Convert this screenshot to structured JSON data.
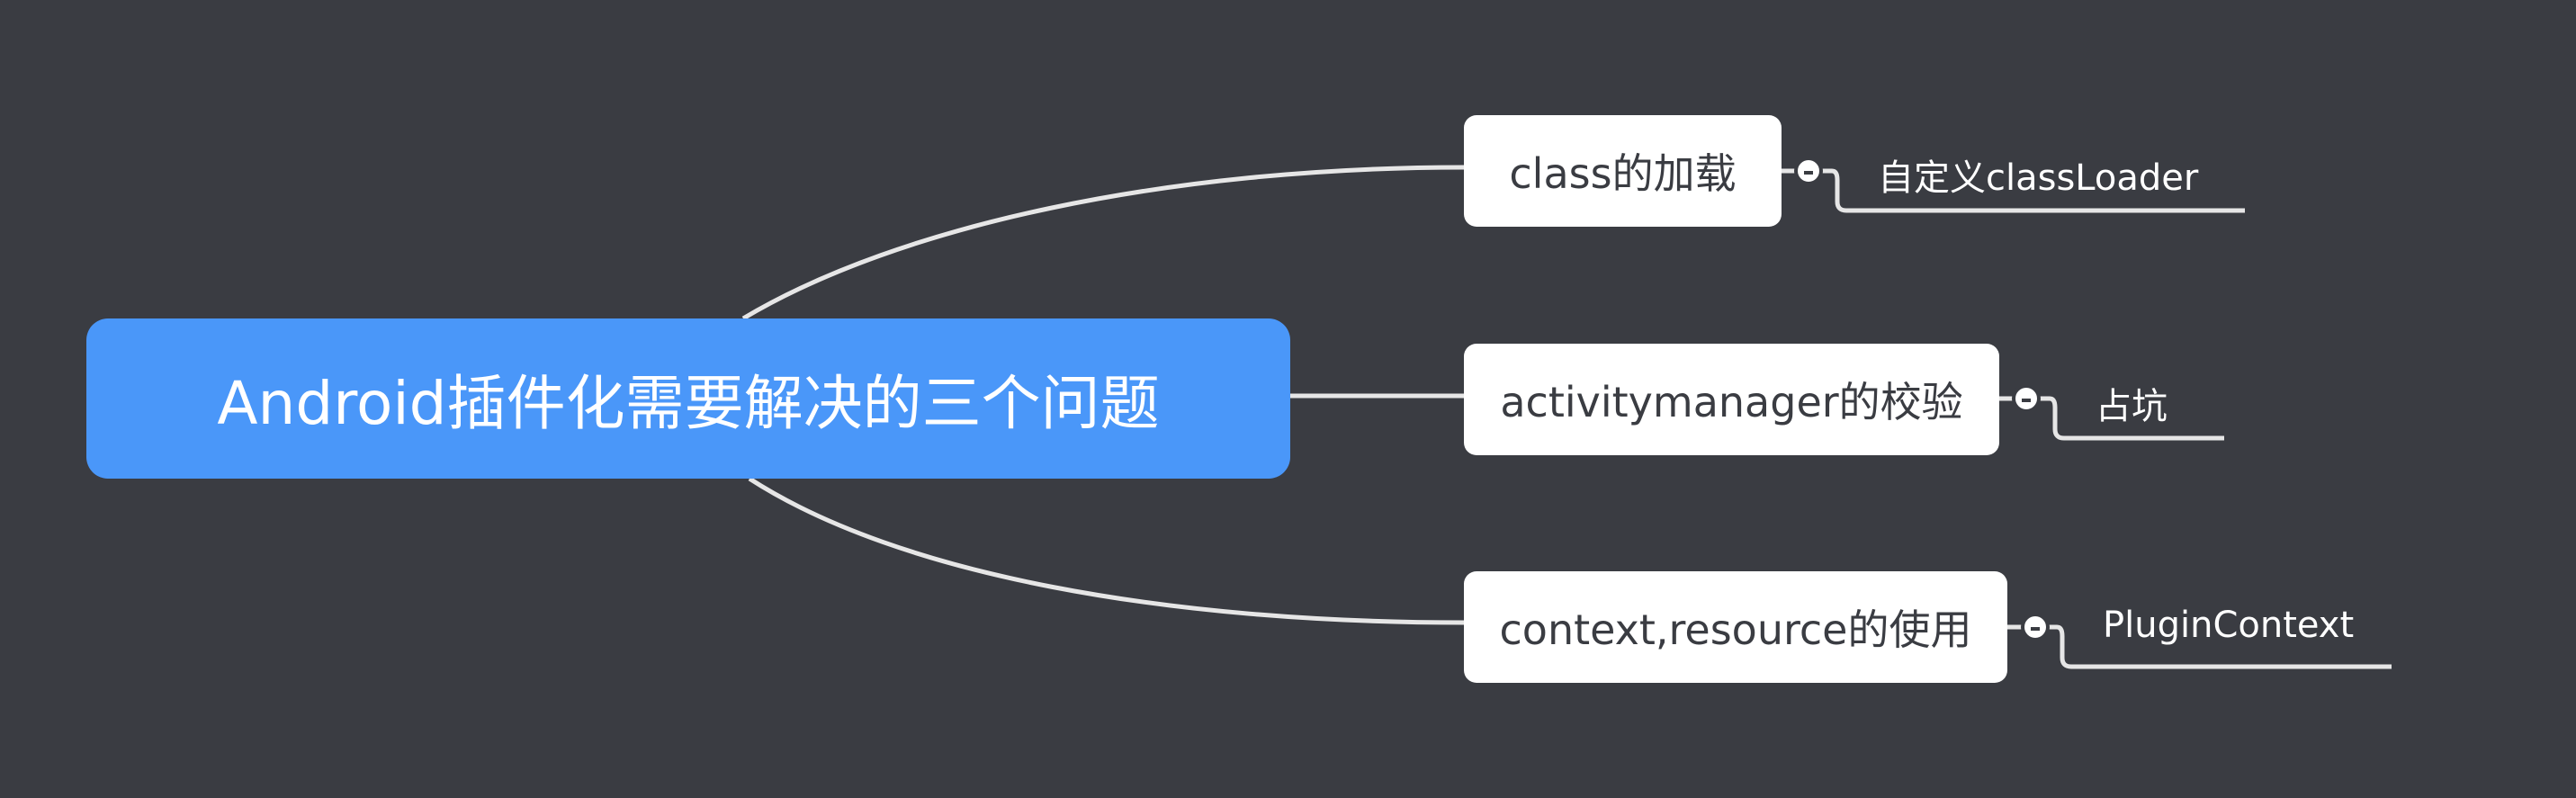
{
  "mindmap": {
    "central_topic": "Android插件化需要解决的三个问题",
    "branches": [
      {
        "label": "class的加载",
        "children": [
          "自定义classLoader"
        ],
        "collapse_icon": "minus-circle-icon"
      },
      {
        "label": "activitymanager的校验",
        "children": [
          "占坑"
        ],
        "collapse_icon": "minus-circle-icon"
      },
      {
        "label": "context,resource的使用",
        "children": [
          "PluginContext"
        ],
        "collapse_icon": "minus-circle-icon"
      }
    ]
  },
  "colors": {
    "background": "#3a3c42",
    "central_fill": "#4a97f9",
    "topic_fill": "#ffffff",
    "topic_text": "#3a3c42",
    "connector": "#e6e6e6",
    "subtopic_text": "#ffffff"
  }
}
